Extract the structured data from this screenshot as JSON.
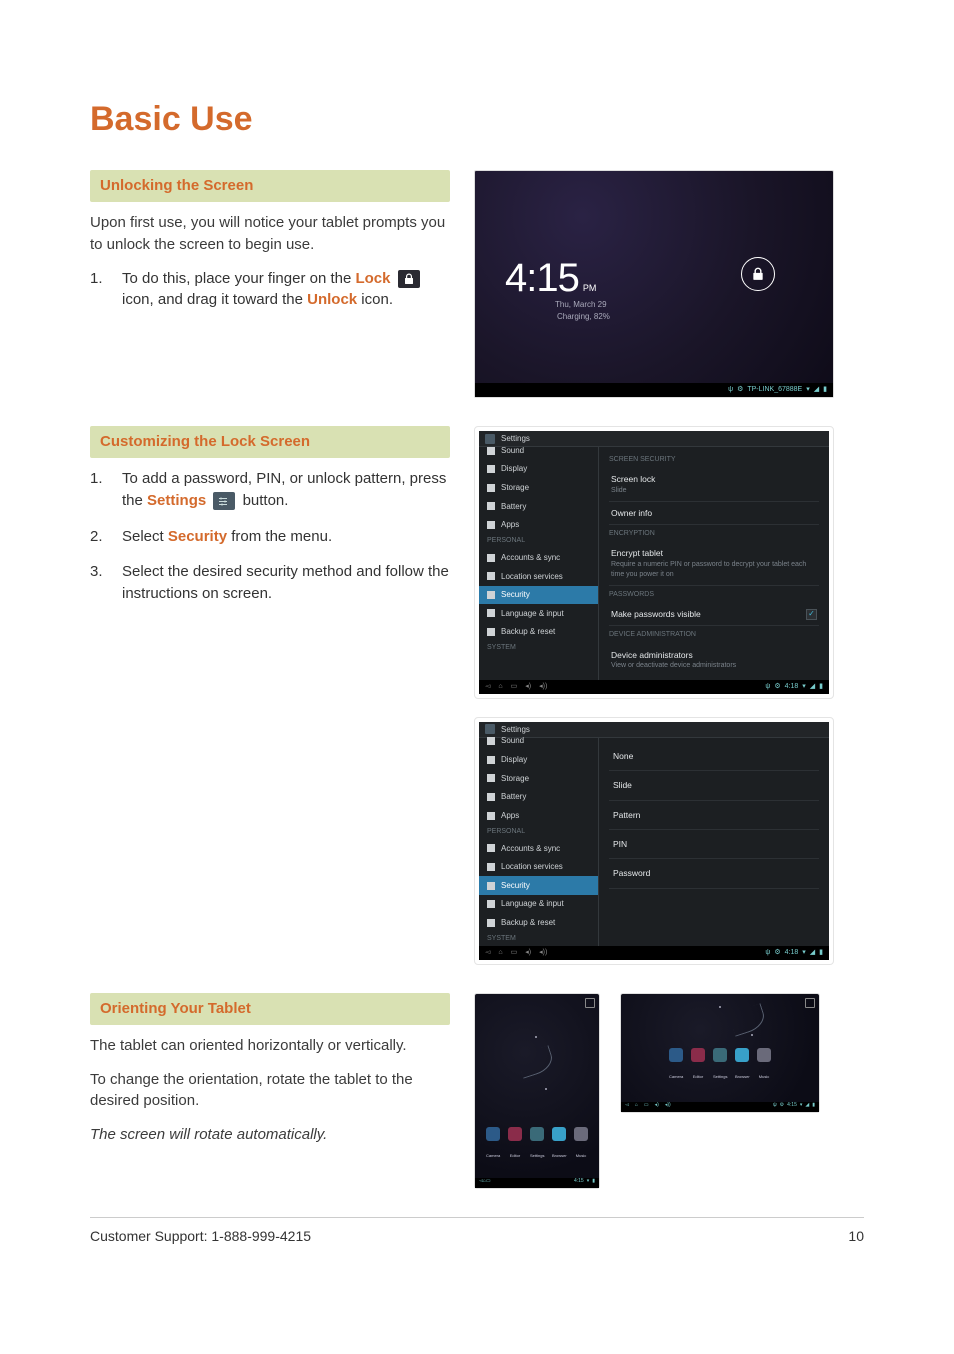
{
  "page_title": "Basic Use",
  "sections": {
    "unlock": {
      "header": "Unlocking the Screen",
      "intro": "Upon first use, you will notice your tablet prompts you to unlock the screen to begin use.",
      "step1_a": "To do this,  place your finger on the ",
      "step1_lock": "Lock",
      "step1_b": " icon, and drag it toward the ",
      "step1_unlock": "Unlock",
      "step1_c": " icon."
    },
    "customize": {
      "header": "Customizing the Lock Screen",
      "step1_a": "To add a password, PIN, or unlock pattern, press the ",
      "step1_settings": "Settings",
      "step1_b": " button.",
      "step2_a": "Select ",
      "step2_security": "Security",
      "step2_b": " from the menu.",
      "step3": "Select the desired security method and follow the instructions on screen."
    },
    "orient": {
      "header": "Orienting Your Tablet",
      "p1": "The tablet can oriented horizontally or vertically.",
      "p2": "To change the orientation, rotate the tablet to the desired position.",
      "p3": "The screen will rotate automatically."
    }
  },
  "lockscreen": {
    "time": "4:15",
    "ampm": "PM",
    "date": "Thu, March 29",
    "charging": "Charging, 82%",
    "wifi": "TP-LINK_67888E"
  },
  "settings_screen": {
    "title": "Settings",
    "left_items": [
      {
        "cat": false,
        "label": "Sound",
        "top_cut": true
      },
      {
        "cat": false,
        "label": "Display"
      },
      {
        "cat": false,
        "label": "Storage"
      },
      {
        "cat": false,
        "label": "Battery"
      },
      {
        "cat": false,
        "label": "Apps"
      },
      {
        "cat": true,
        "label": "PERSONAL"
      },
      {
        "cat": false,
        "label": "Accounts & sync"
      },
      {
        "cat": false,
        "label": "Location services"
      },
      {
        "cat": false,
        "label": "Security",
        "selected": true
      },
      {
        "cat": false,
        "label": "Language & input"
      },
      {
        "cat": false,
        "label": "Backup & reset"
      },
      {
        "cat": true,
        "label": "SYSTEM"
      }
    ],
    "right": {
      "h1": "SCREEN SECURITY",
      "screen_lock": "Screen lock",
      "screen_lock_sub": "Slide",
      "owner_info": "Owner info",
      "h2": "ENCRYPTION",
      "encrypt_t": "Encrypt tablet",
      "encrypt_s": "Require a numeric PIN or password to decrypt your tablet each time you power it on",
      "h3": "PASSWORDS",
      "pwd_vis": "Make passwords visible",
      "h4": "DEVICE ADMINISTRATION",
      "dev_admin": "Device administrators",
      "dev_admin_s": "View or deactivate device administrators"
    },
    "time": "4:18"
  },
  "options_screen": {
    "options": [
      "None",
      "Slide",
      "Pattern",
      "PIN",
      "Password"
    ]
  },
  "home_apps": [
    {
      "label": "Camera",
      "color": "#2c5a88"
    },
    {
      "label": "Editor",
      "color": "#8a2c4a"
    },
    {
      "label": "Settings",
      "color": "#3a6a78"
    },
    {
      "label": "Browser",
      "color": "#38a0c8"
    },
    {
      "label": "Music",
      "color": "#6a6a7a"
    }
  ],
  "home_time": "4:15",
  "footer": {
    "support": "Customer Support: 1-888-999-4215",
    "page": "10"
  }
}
